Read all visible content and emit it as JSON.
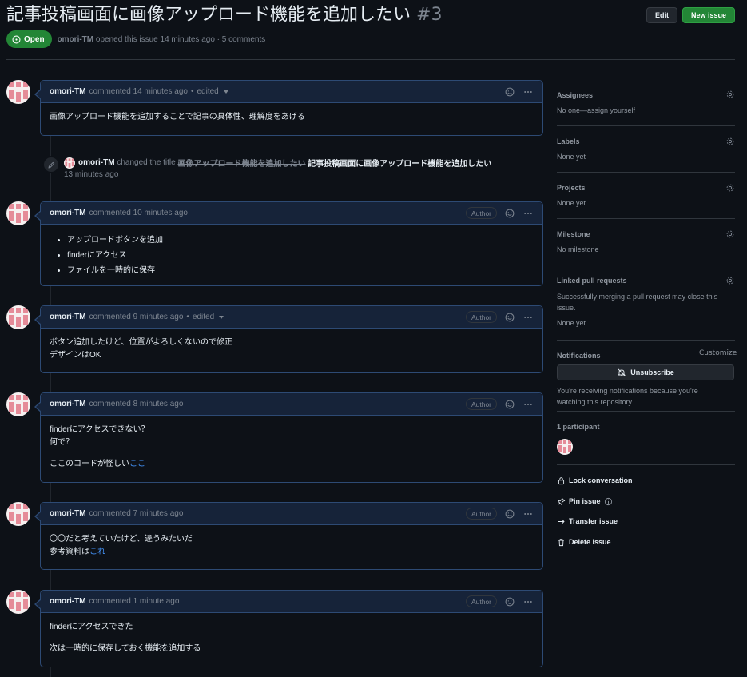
{
  "issue": {
    "title": "記事投稿画面に画像アップロード機能を追加したい",
    "number": "#3",
    "state": "Open",
    "meta_author": "omori-TM",
    "meta_rest": "opened this issue 14 minutes ago · 5 comments"
  },
  "header_buttons": {
    "edit": "Edit",
    "new_issue": "New issue"
  },
  "comments": [
    {
      "author": "omori-TM",
      "action": "commented",
      "time": "14 minutes ago",
      "edited": "edited",
      "badge": "",
      "lines": [
        "画像アップロード機能を追加することで記事の具体性、理解度をあげる"
      ]
    },
    {
      "author": "omori-TM",
      "action": "commented",
      "time": "10 minutes ago",
      "badge": "Author",
      "list": [
        "アップロードボタンを追加",
        "finderにアクセス",
        "ファイルを一時的に保存"
      ]
    },
    {
      "author": "omori-TM",
      "action": "commented",
      "time": "9 minutes ago",
      "edited": "edited",
      "badge": "Author",
      "lines": [
        "ボタン追加したけど、位置がよろしくないので修正",
        "デザインはOK"
      ]
    },
    {
      "author": "omori-TM",
      "action": "commented",
      "time": "8 minutes ago",
      "badge": "Author",
      "lines": [
        "finderにアクセスできない？",
        "何で？"
      ],
      "link_prefix": "ここのコードが怪しい",
      "link_text": "ここ"
    },
    {
      "author": "omori-TM",
      "action": "commented",
      "time": "7 minutes ago",
      "badge": "Author",
      "lines": [
        "〇〇だと考えていたけど、違うみたいだ"
      ],
      "link_prefix": "参考資料は",
      "link_text": "これ"
    },
    {
      "author": "omori-TM",
      "action": "commented",
      "time": "1 minute ago",
      "badge": "Author",
      "lines": [
        "finderにアクセスできた",
        "次は一時的に保存しておく機能を追加する"
      ]
    }
  ],
  "event": {
    "actor": "omori-TM",
    "verb": "changed the title",
    "old_title": "画像アップロード機能を追加したい",
    "new_title": "記事投稿画面に画像アップロード機能を追加したい",
    "time": "13 minutes ago"
  },
  "sidebar": {
    "assignees": {
      "title": "Assignees",
      "value": "No one—assign yourself"
    },
    "labels": {
      "title": "Labels",
      "value": "None yet"
    },
    "projects": {
      "title": "Projects",
      "value": "None yet"
    },
    "milestone": {
      "title": "Milestone",
      "value": "No milestone"
    },
    "linked": {
      "title": "Linked pull requests",
      "desc": "Successfully merging a pull request may close this issue.",
      "value": "None yet"
    },
    "notifications": {
      "title": "Notifications",
      "customize": "Customize",
      "button": "Unsubscribe",
      "desc": "You're receiving notifications because you're watching this repository."
    },
    "participants": {
      "title": "1 participant"
    },
    "actions": {
      "lock": "Lock conversation",
      "pin": "Pin issue",
      "transfer": "Transfer issue",
      "delete": "Delete issue"
    }
  },
  "colors": {
    "background": "#0d1117",
    "comment_header": "#162339",
    "comment_border": "#2d4a74",
    "open_green": "#238636",
    "link": "#4493f8",
    "muted": "#7d8590"
  }
}
